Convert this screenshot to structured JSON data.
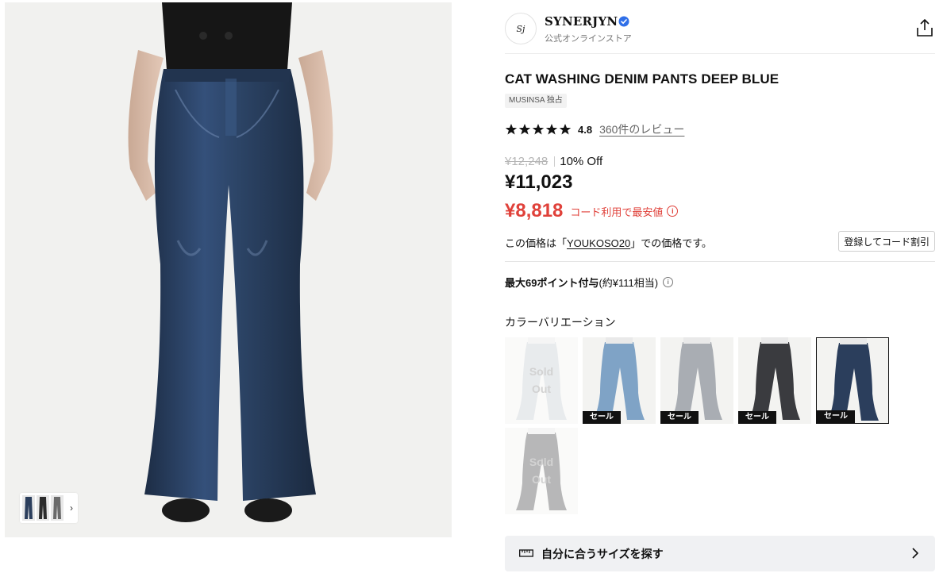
{
  "brand": {
    "logo_text": "Sj",
    "name": "SYNERJYN",
    "verified_icon": "verified-badge-icon",
    "subtitle": "公式オンラインストア"
  },
  "share_icon": "share-icon",
  "product": {
    "title": "CAT WASHING DENIM PANTS DEEP BLUE",
    "exclusive_tag": "MUSINSA 独占",
    "rating": "4.8",
    "stars": 5,
    "reviews_link": "360件のレビュー"
  },
  "pricing": {
    "original": "¥12,248",
    "discount": "10% Off",
    "price": "¥11,023",
    "best_price": "¥8,818",
    "best_label": "コード利用で最安値",
    "coupon_prefix": "この価格は「",
    "coupon_code": "YOUKOSO20",
    "coupon_suffix": "」での価格です。",
    "coupon_button": "登録してコード割引"
  },
  "points": {
    "main": "最大69ポイント付与",
    "sub": "(約¥111相当)"
  },
  "colors": {
    "label": "カラーバリエーション",
    "sale_label": "セール",
    "soldout_line1": "Sold",
    "soldout_line2": "Out",
    "variants": [
      {
        "tone": "#cdd2d8",
        "sold_out": true,
        "sale": false,
        "selected": false
      },
      {
        "tone": "#7fa3c6",
        "sold_out": false,
        "sale": true,
        "selected": false
      },
      {
        "tone": "#a9adb3",
        "sold_out": false,
        "sale": true,
        "selected": false
      },
      {
        "tone": "#3a3b3f",
        "sold_out": false,
        "sale": true,
        "selected": false
      },
      {
        "tone": "#2b3e5c",
        "sold_out": false,
        "sale": true,
        "selected": true
      },
      {
        "tone": "#5f6062",
        "sold_out": true,
        "sale": false,
        "selected": false
      }
    ]
  },
  "size_finder": {
    "label": "自分に合うサイズを探す",
    "icon": "ruler-icon"
  },
  "colors_palette": {
    "accent_red": "#e0413a",
    "denim_dark": "#263a57"
  }
}
